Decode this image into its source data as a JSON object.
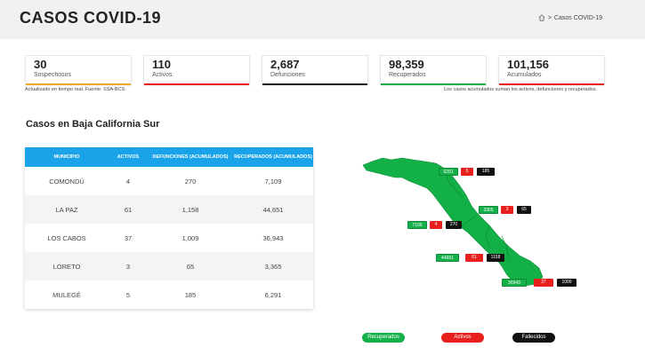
{
  "header": {
    "title": "CASOS COVID-19",
    "breadcrumb_sep": ">",
    "breadcrumb_current": "Casos COVID-19"
  },
  "cards": [
    {
      "value": "30",
      "label": "Sospechosos",
      "color": "#f5a623"
    },
    {
      "value": "110",
      "label": "Activos",
      "color": "#e8201d"
    },
    {
      "value": "2,687",
      "label": "Defunciones",
      "color": "#222222"
    },
    {
      "value": "98,359",
      "label": "Recuperados",
      "color": "#15b04a"
    },
    {
      "value": "101,156",
      "label": "Acumulados",
      "color": "#e8201d"
    }
  ],
  "notes": {
    "left": "Actualizado en tiempo real. Fuente: SSA-BCS.",
    "right": "Los casos acumulados suman los activos, defunciones y recuperados."
  },
  "section_title": "Casos en Baja California Sur",
  "table": {
    "headers": [
      "MUNICIPIO",
      "ACTIVOS",
      "DEFUNCIONES (ACUMULADOS)",
      "RECUPERADOS (ACUMULADOS)"
    ],
    "rows": [
      [
        "COMONDÚ",
        "4",
        "270",
        "7,109"
      ],
      [
        "LA PAZ",
        "61",
        "1,158",
        "44,651"
      ],
      [
        "LOS CABOS",
        "37",
        "1,009",
        "36,943"
      ],
      [
        "LORETO",
        "3",
        "65",
        "3,365"
      ],
      [
        "MULEGÉ",
        "5",
        "185",
        "6,291"
      ]
    ]
  },
  "map": {
    "chips": {
      "mulege": [
        "6291",
        "5",
        "185"
      ],
      "loreto": [
        "3365",
        "3",
        "65"
      ],
      "comondu": [
        "7109",
        "4",
        "270"
      ],
      "lapaz": [
        "44651",
        "61",
        "1158"
      ],
      "loscabos": [
        "36943",
        "37",
        "1009"
      ]
    },
    "land_color": "#12b046"
  },
  "legend": {
    "recuperados": "Recuperados",
    "activos": "Activos",
    "fallecidos": "Fallecidos"
  }
}
